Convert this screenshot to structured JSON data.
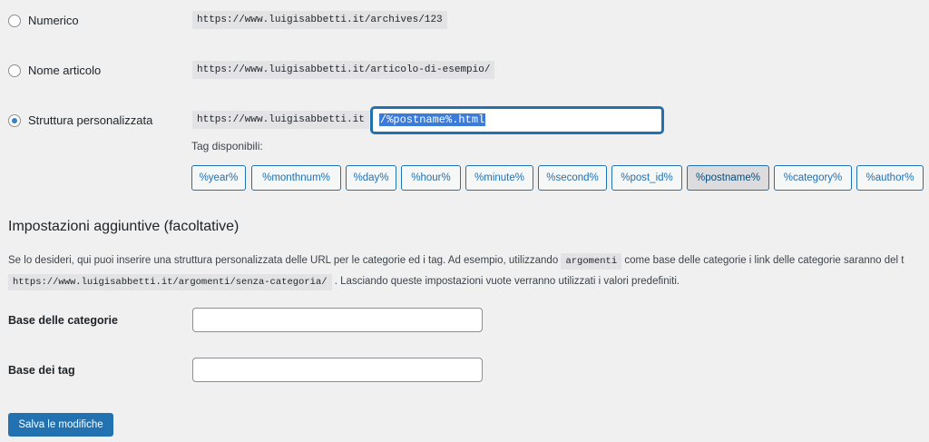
{
  "options": [
    {
      "label": "Numerico",
      "example": "https://www.luigisabbetti.it/archives/123",
      "checked": false
    },
    {
      "label": "Nome articolo",
      "example": "https://www.luigisabbetti.it/articolo-di-esempio/",
      "checked": false
    },
    {
      "label": "Struttura personalizzata",
      "example": "https://www.luigisabbetti.it",
      "checked": true
    }
  ],
  "custom_structure": {
    "value": "/%postname%.html",
    "tags_label": "Tag disponibili:",
    "tags": [
      "%year%",
      "%monthnum%",
      "%day%",
      "%hour%",
      "%minute%",
      "%second%",
      "%post_id%",
      "%postname%",
      "%category%",
      "%author%"
    ],
    "active_tag": "%postname%"
  },
  "optional": {
    "heading": "Impostazioni aggiuntive (facoltative)",
    "desc_part1": "Se lo desideri, qui puoi inserire una struttura personalizzata delle URL per le categorie ed i tag. Ad esempio, utilizzando",
    "desc_code1": "argomenti",
    "desc_part2": "come base delle categorie i link delle categorie saranno del t",
    "desc_code2": "https://www.luigisabbetti.it/argomenti/senza-categoria/",
    "desc_part3": ". Lasciando queste impostazioni vuote verranno utilizzati i valori predefiniti.",
    "category_base_label": "Base delle categorie",
    "category_base_value": "",
    "tag_base_label": "Base dei tag",
    "tag_base_value": ""
  },
  "save_label": "Salva le modifiche",
  "colors": {
    "accent": "#2271b1",
    "background": "#f0f0f1",
    "code_bg": "#e3e3e5"
  }
}
